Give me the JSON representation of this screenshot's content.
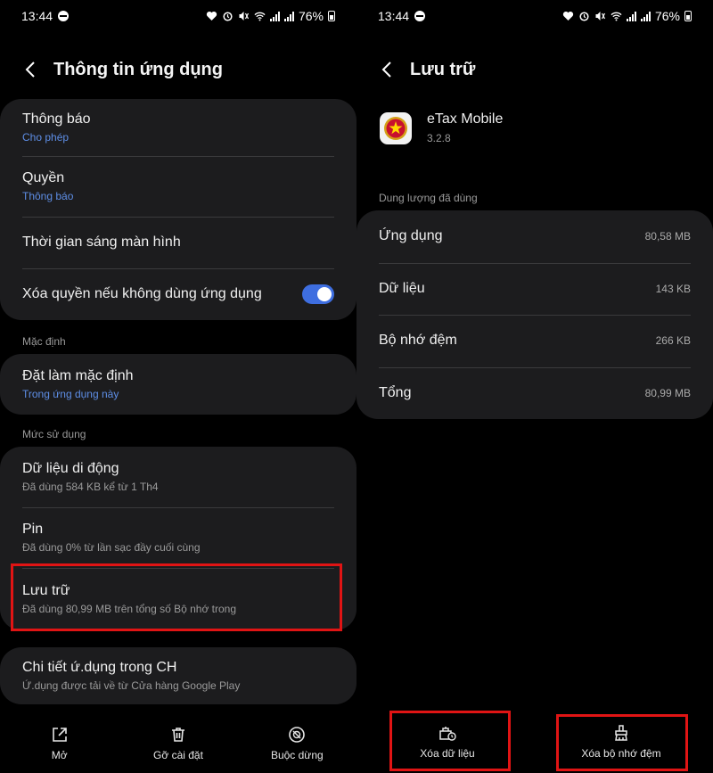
{
  "status_bar": {
    "time": "13:44",
    "battery": "76%"
  },
  "left": {
    "header": {
      "title": "Thông tin ứng dụng"
    },
    "card1": [
      {
        "title": "Thông báo",
        "sub": "Cho phép"
      },
      {
        "title": "Quyền",
        "sub": "Thông báo"
      },
      {
        "title": "Thời gian sáng màn hình"
      },
      {
        "title": "Xóa quyền nếu không dùng ứng dụng",
        "toggle_on": true
      }
    ],
    "section_default": "Mặc định",
    "default_row": {
      "title": "Đặt làm mặc định",
      "sub": "Trong ứng dụng này"
    },
    "section_usage": "Mức sử dụng",
    "usage": [
      {
        "title": "Dữ liệu di động",
        "sub": "Đã dùng 584 KB kể từ 1 Th4"
      },
      {
        "title": "Pin",
        "sub": "Đã dùng 0% từ lần sạc đầy cuối cùng"
      },
      {
        "title": "Lưu trữ",
        "sub": "Đã dùng 80,99 MB trên tổng số Bộ nhớ trong"
      }
    ],
    "store_row": {
      "title": "Chi tiết ứ.dụng trong CH",
      "sub": "Ứ.dụng được tải về từ Cửa hàng Google Play"
    },
    "bottom": {
      "open": "Mở",
      "uninstall": "Gỡ cài đặt",
      "force_stop": "Buộc dừng"
    }
  },
  "right": {
    "header": {
      "title": "Lưu trữ"
    },
    "app": {
      "name": "eTax Mobile",
      "version": "3.2.8"
    },
    "section_used": "Dung lượng đã dùng",
    "storage": [
      {
        "label": "Ứng dụng",
        "value": "80,58 MB"
      },
      {
        "label": "Dữ liệu",
        "value": "143 KB"
      },
      {
        "label": "Bộ nhớ đệm",
        "value": "266 KB"
      },
      {
        "label": "Tổng",
        "value": "80,99 MB"
      }
    ],
    "bottom": {
      "clear_data": "Xóa dữ liệu",
      "clear_cache": "Xóa bộ nhớ đệm"
    }
  },
  "colors": {
    "accent_blue": "#3e6ee0",
    "highlight_red": "#e01414",
    "card_bg": "#1c1c1e"
  }
}
